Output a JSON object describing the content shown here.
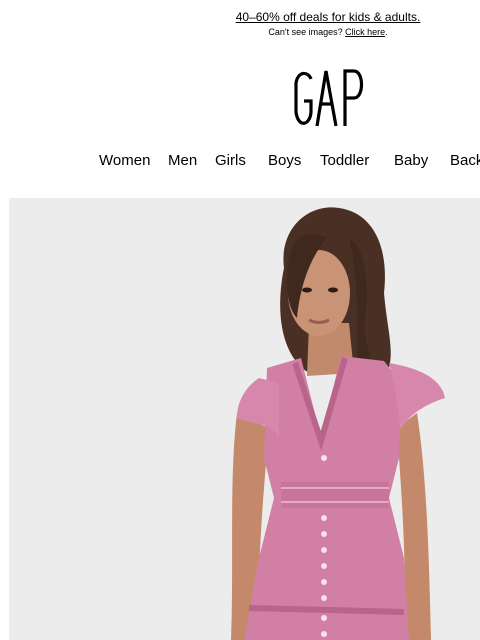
{
  "preheader": {
    "promo_text": "40–60% off deals for kids & adults.",
    "cant_see_text": "Can't see images?",
    "click_here": "Click here",
    "period": "."
  },
  "logo": {
    "text": "GAP",
    "icon": "gap-logo"
  },
  "nav": {
    "items": [
      {
        "label": "Women"
      },
      {
        "label": "Men"
      },
      {
        "label": "Girls"
      },
      {
        "label": "Boys"
      },
      {
        "label": "Toddler"
      },
      {
        "label": "Baby"
      },
      {
        "label": "Back"
      }
    ]
  },
  "hero": {
    "image": "woman-in-pink-dress-photo",
    "colors": {
      "background": "#ececec",
      "dress": "#d27fa5",
      "hair": "#4a3024",
      "skin": "#c99476"
    }
  }
}
